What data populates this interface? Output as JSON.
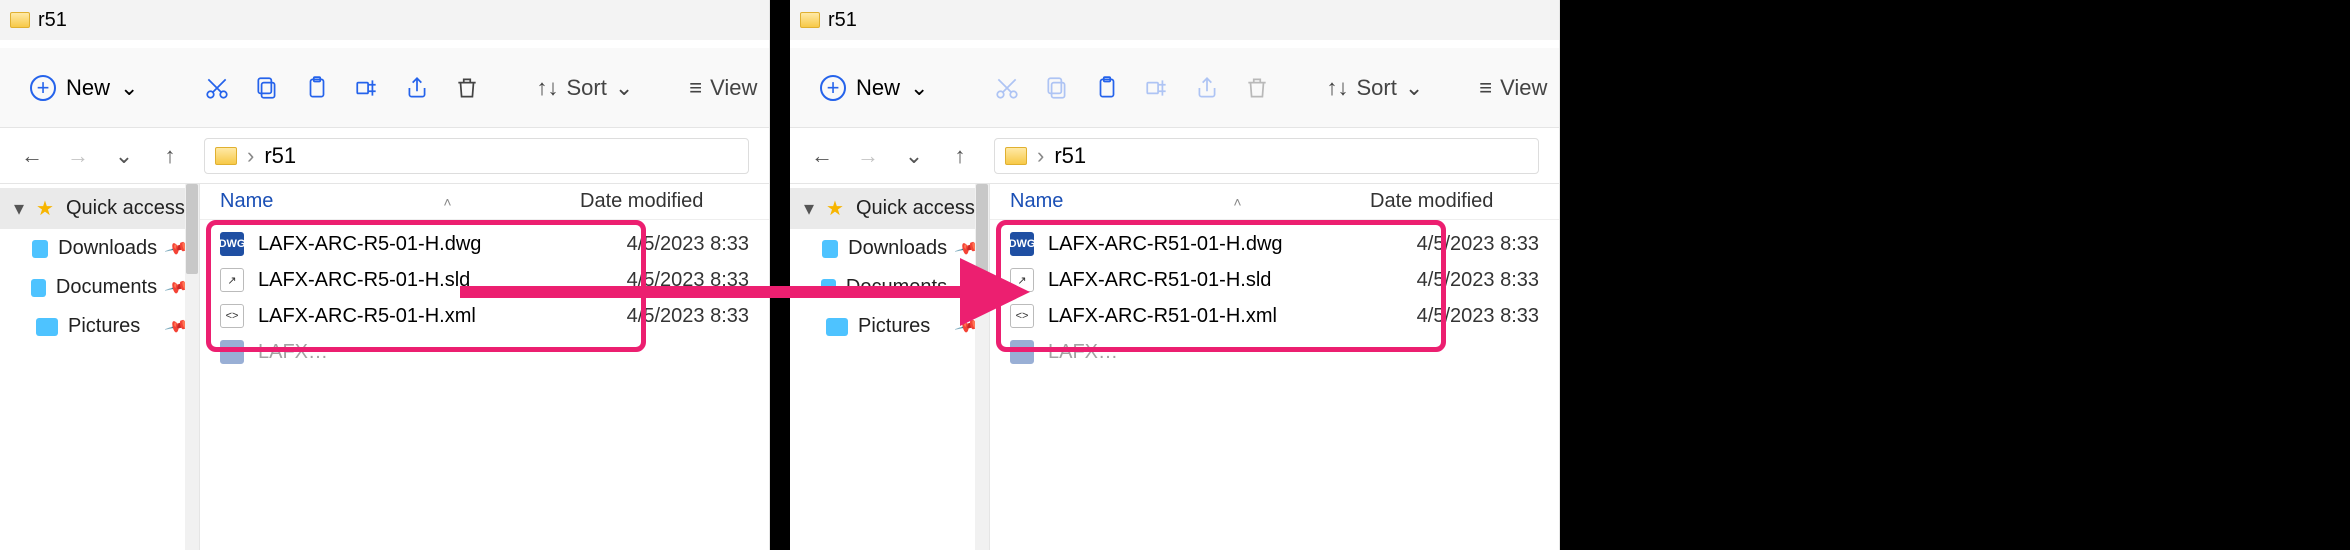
{
  "left": {
    "title": "r51",
    "toolbar": {
      "new_label": "New",
      "sort_label": "Sort",
      "view_label": "View"
    },
    "path": {
      "folder": "r51",
      "sep": "›"
    },
    "sidebar": {
      "items": [
        {
          "label": "Quick access"
        },
        {
          "label": "Downloads"
        },
        {
          "label": "Documents"
        },
        {
          "label": "Pictures"
        }
      ]
    },
    "columns": {
      "name": "Name",
      "date": "Date modified"
    },
    "files": [
      {
        "name": "LAFX-ARC-R5-01-H.dwg",
        "date": "4/5/2023 8:33",
        "type": "dwg"
      },
      {
        "name": "LAFX-ARC-R5-01-H.sld",
        "date": "4/5/2023 8:33",
        "type": "sld"
      },
      {
        "name": "LAFX-ARC-R5-01-H.xml",
        "date": "4/5/2023 8:33",
        "type": "xml"
      }
    ]
  },
  "right": {
    "title": "r51",
    "toolbar": {
      "new_label": "New",
      "sort_label": "Sort",
      "view_label": "View"
    },
    "path": {
      "folder": "r51",
      "sep": "›"
    },
    "sidebar": {
      "items": [
        {
          "label": "Quick access"
        },
        {
          "label": "Downloads"
        },
        {
          "label": "Documents"
        },
        {
          "label": "Pictures"
        }
      ]
    },
    "columns": {
      "name": "Name",
      "date": "Date modified"
    },
    "files": [
      {
        "name": "LAFX-ARC-R51-01-H.dwg",
        "date": "4/5/2023 8:33",
        "type": "dwg"
      },
      {
        "name": "LAFX-ARC-R51-01-H.sld",
        "date": "4/5/2023 8:33",
        "type": "sld"
      },
      {
        "name": "LAFX-ARC-R51-01-H.xml",
        "date": "4/5/2023 8:33",
        "type": "xml"
      }
    ]
  },
  "highlight_color": "#ec1f70"
}
